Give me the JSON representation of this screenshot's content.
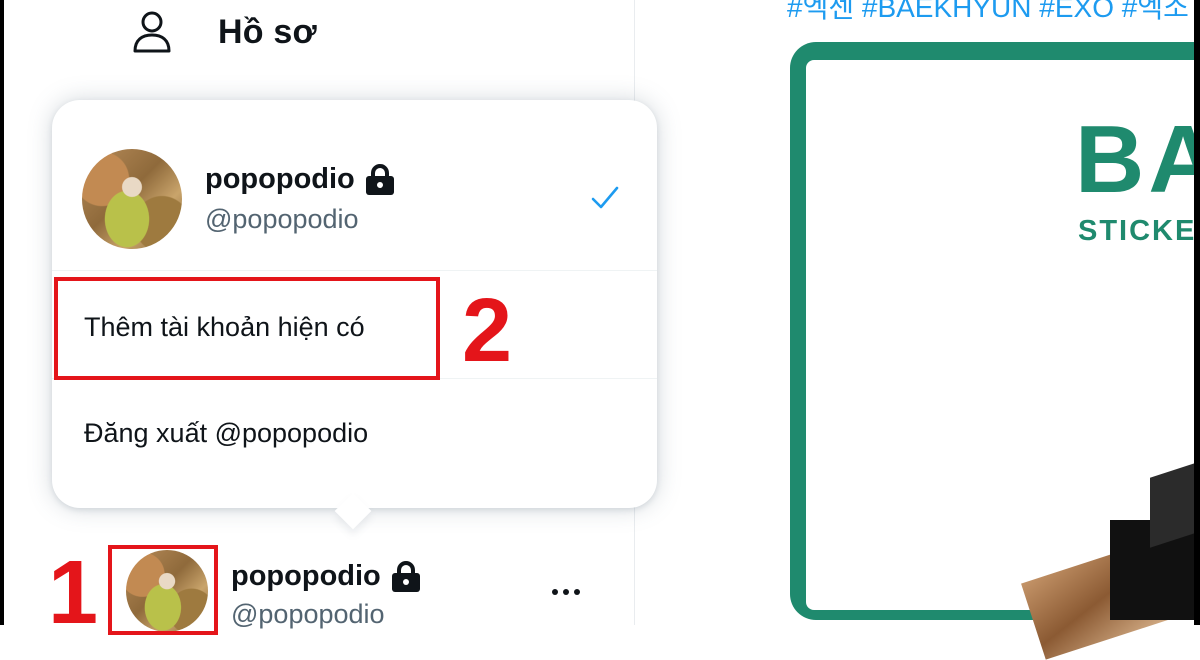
{
  "nav": {
    "profile_label": "Hồ sơ",
    "icon": "person-icon"
  },
  "popover": {
    "current_account": {
      "name": "popopodio",
      "handle": "@popopodio",
      "protected_icon": "lock-icon",
      "selected_icon": "checkmark-icon"
    },
    "add_existing_account_label": "Thêm tài khoản hiện có",
    "logout_label": "Đăng xuất @popopodio"
  },
  "bottom_account": {
    "name": "popopodio",
    "handle": "@popopodio",
    "more_icon": "more-icon"
  },
  "annotations": {
    "step1": "1",
    "step2": "2",
    "color": "#e4151a"
  },
  "content": {
    "hashtags": "#엑센 #BAEKHYUN #EXO #엑소",
    "brand_title": "BA",
    "brand_subtitle": "STICKE",
    "accent_color": "#1f8a6e"
  },
  "colors": {
    "link": "#1d9bf0",
    "secondary_text": "#536471"
  }
}
